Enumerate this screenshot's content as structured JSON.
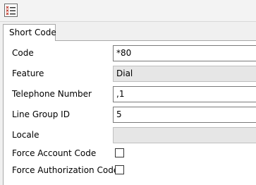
{
  "window": {
    "icon": "list-icon"
  },
  "tabs": [
    {
      "label": "Short Code",
      "selected": true
    }
  ],
  "form": {
    "code": {
      "label": "Code",
      "value": "*80"
    },
    "feature": {
      "label": "Feature",
      "value": "Dial"
    },
    "telephone_number": {
      "label": "Telephone Number",
      "value": ",1"
    },
    "line_group_id": {
      "label": "Line Group ID",
      "value": "5"
    },
    "locale": {
      "label": "Locale",
      "value": ""
    },
    "force_account_code": {
      "label": "Force Account Code",
      "checked": false
    },
    "force_authorization_code": {
      "label": "Force Authorization Code",
      "checked": false
    }
  },
  "colors": {
    "window_bg": "#f0f0f0",
    "panel_bg": "#ffffff",
    "disabled_field_bg": "#e6e6e6",
    "icon_accent": "#c0392b"
  }
}
